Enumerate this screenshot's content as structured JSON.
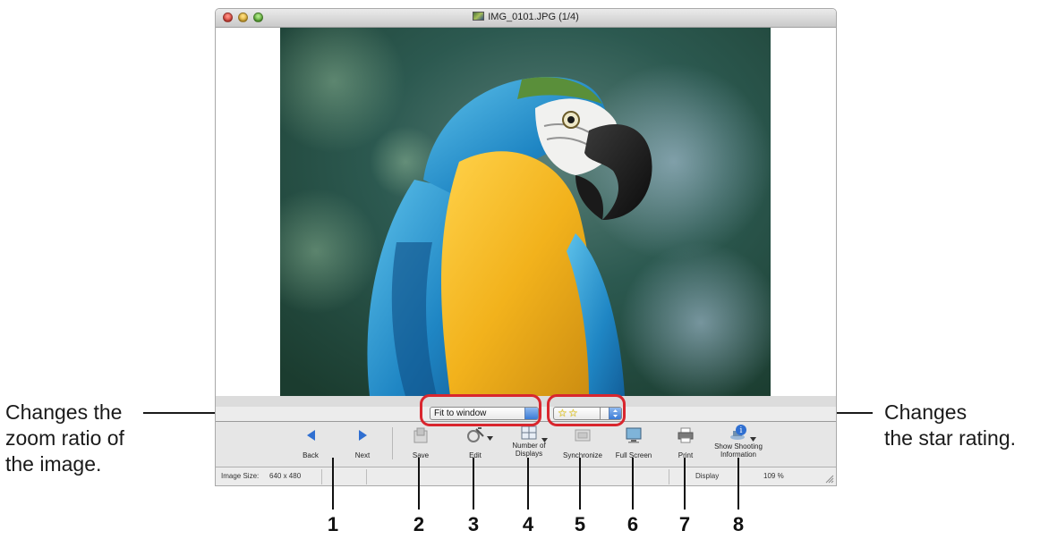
{
  "window": {
    "title": "IMG_0101.JPG (1/4)"
  },
  "zoom": {
    "selected": "Fit to window"
  },
  "rating": {
    "stars": 2,
    "max": 5
  },
  "toolbar": {
    "back_label": "Back",
    "next_label": "Next",
    "save_label": "Save",
    "edit_label": "Edit",
    "displays_label_1": "Number of",
    "displays_label_2": "Displays",
    "sync_label": "Synchronize",
    "fullscreen_label": "Full Screen",
    "print_label": "Print",
    "shooting_label_1": "Show Shooting",
    "shooting_label_2": "Information"
  },
  "status": {
    "image_size_label": "Image Size:",
    "image_size_value": "640 x 480",
    "display_label": "Display",
    "zoom_value": "109 %"
  },
  "annotations": {
    "left_line1": "Changes the",
    "left_line2": "zoom ratio of",
    "left_line3": "the image.",
    "right_line1": "Changes",
    "right_line2": "the star rating.",
    "numbers": [
      "1",
      "2",
      "3",
      "4",
      "5",
      "6",
      "7",
      "8"
    ]
  },
  "colors": {
    "highlight": "#d9262e",
    "star": "#f1d300",
    "accent_blue": "#2f6fd1"
  }
}
